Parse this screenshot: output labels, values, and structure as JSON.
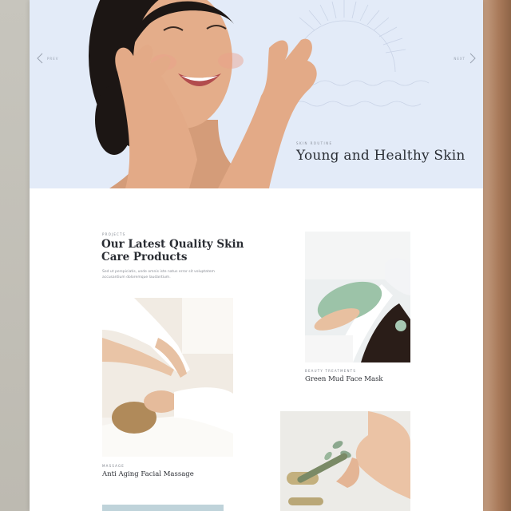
{
  "hero": {
    "prev_label": "PREV",
    "next_label": "NEXT",
    "eyebrow": "SKIN ROUTINE",
    "title": "Young and Healthy Skin",
    "background": "#e3ebf8"
  },
  "projects": {
    "eyebrow": "PROJECTS",
    "title": "Our Latest Quality Skin Care Products",
    "description": "Sed ut perspiciatis, unde omnis iste natus error sit voluptatem accusantium doloremque laudantium."
  },
  "cards": [
    {
      "category": "MASSAGE",
      "title": "Anti Aging Facial Massage"
    },
    {
      "category": "BEAUTY TREATMENTS",
      "title": "Green Mud Face Mask"
    },
    {
      "category": "",
      "title": ""
    }
  ],
  "colors": {
    "text_dark": "#2a2d33",
    "text_muted": "#8a8e96",
    "accent_strip": "#bfd3da"
  }
}
